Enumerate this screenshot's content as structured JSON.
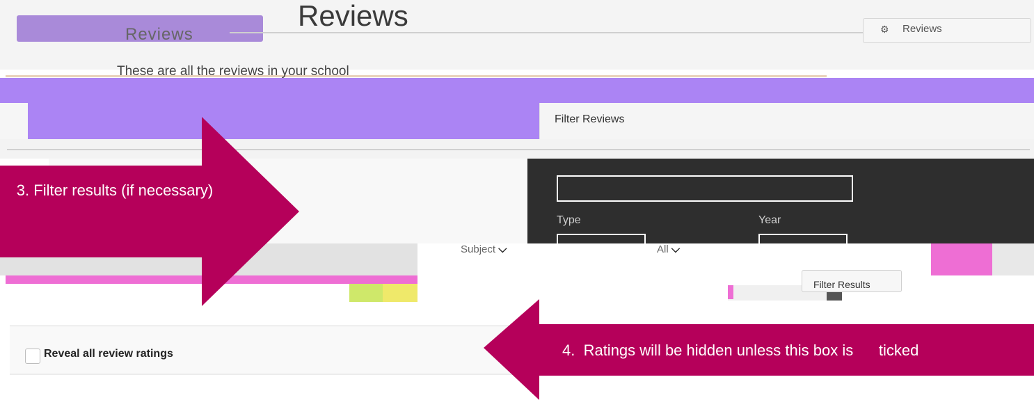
{
  "header": {
    "title": "Reviews",
    "title_echo": "Reviews",
    "subtitle": "These are all the reviews in your school",
    "right_button_label": "Reviews",
    "right_button_icon": "gear-icon"
  },
  "filter": {
    "title": "Filter Reviews",
    "type_label": "Type",
    "year_label": "Year",
    "type_value": "Subject",
    "year_value": "All",
    "filter_button": "Filter Results"
  },
  "reveal": {
    "label": "Reveal all review ratings",
    "checked": false
  },
  "callouts": {
    "step3": "3. Filter results (if necessary)",
    "step4": "4.  Ratings will be hidden unless this box is      ticked"
  },
  "colors": {
    "accent_purple": "#ab84f4",
    "callout_magenta": "#b5005a",
    "panel_dark": "#2e2e2e",
    "pink": "#ee6ed4"
  }
}
